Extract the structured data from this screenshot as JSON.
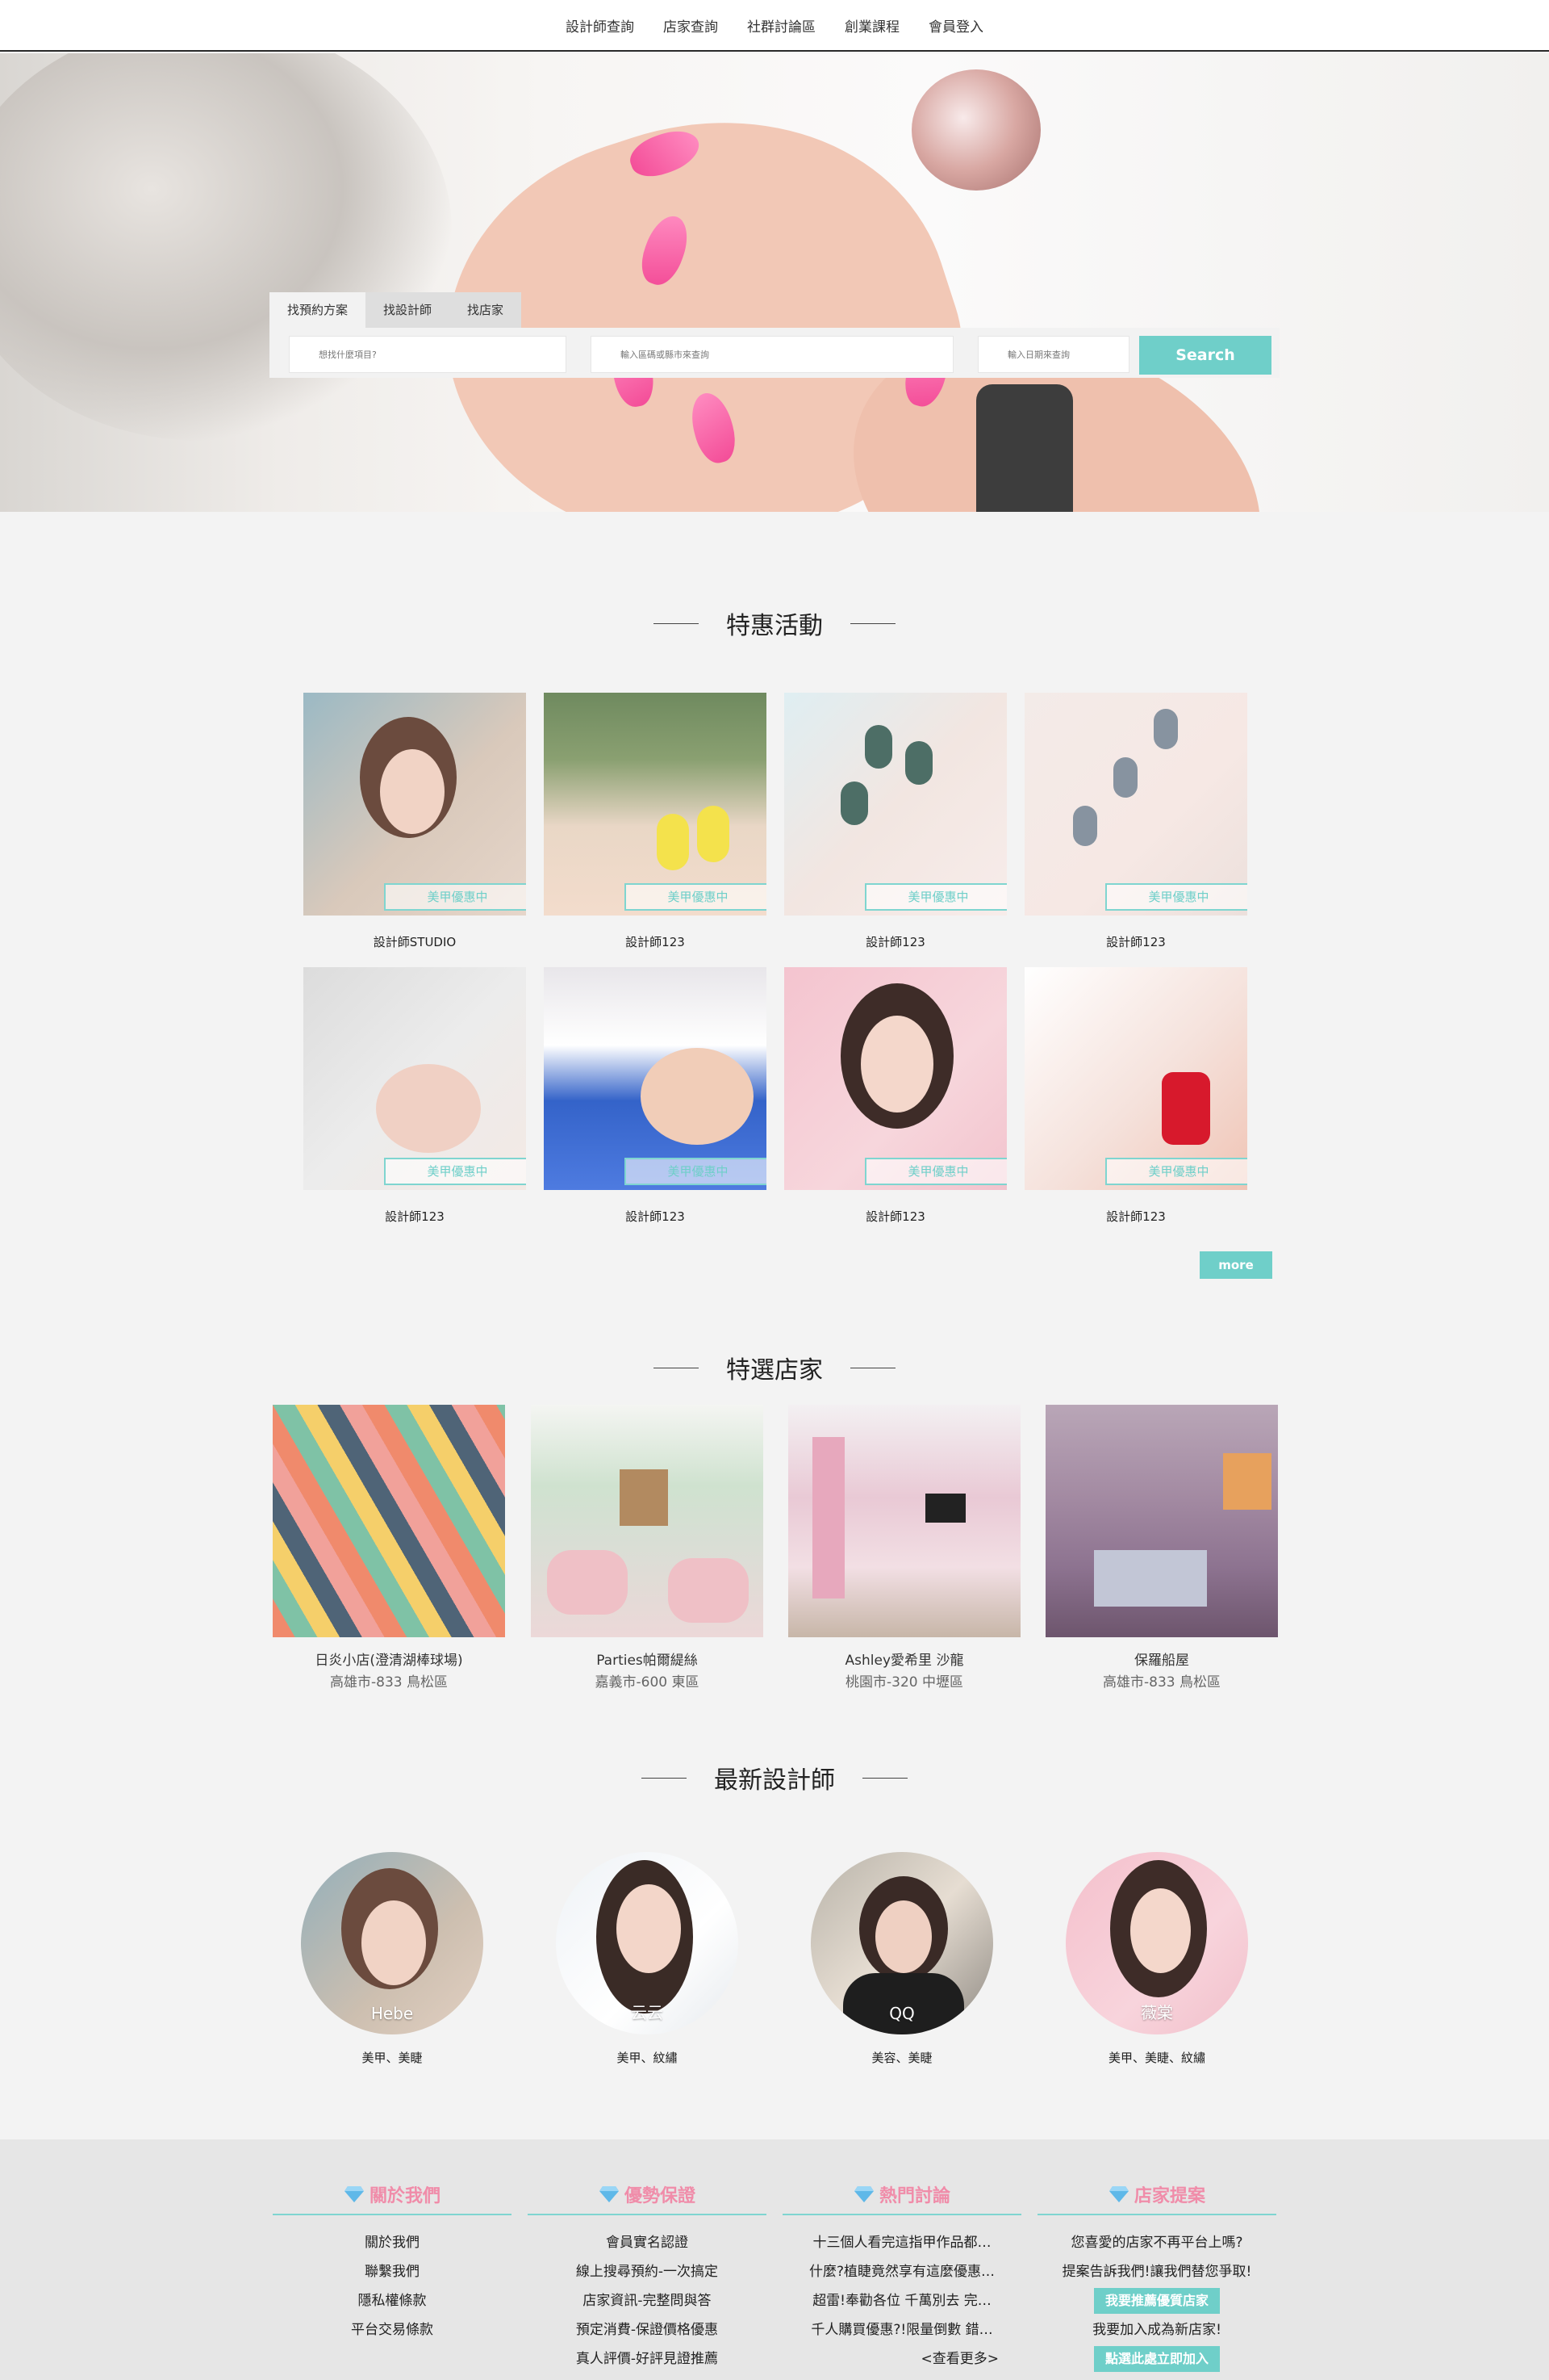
{
  "nav": [
    "設計師查詢",
    "店家查詢",
    "社群討論區",
    "創業課程",
    "會員登入"
  ],
  "search": {
    "tabs": [
      "找預約方案",
      "找設計師",
      "找店家"
    ],
    "item_placeholder": "想找什麼項目?",
    "area_placeholder": "輸入區碼或縣市來查詢",
    "date_placeholder": "輸入日期來查詢",
    "button": "Search"
  },
  "promos": {
    "title": "特惠活動",
    "badge": "美甲優惠中",
    "items": [
      {
        "name": "設計師STUDIO"
      },
      {
        "name": "設計師123"
      },
      {
        "name": "設計師123"
      },
      {
        "name": "設計師123"
      },
      {
        "name": "設計師123"
      },
      {
        "name": "設計師123"
      },
      {
        "name": "設計師123"
      },
      {
        "name": "設計師123"
      }
    ],
    "more": "more"
  },
  "shops": {
    "title": "特選店家",
    "items": [
      {
        "name": "日炎小店(澄清湖棒球場)",
        "addr": "高雄市-833 鳥松區"
      },
      {
        "name": "Parties帕爾緹絲",
        "addr": "嘉義市-600 東區"
      },
      {
        "name": "Ashley愛希里 沙龍",
        "addr": "桃園市-320 中壢區"
      },
      {
        "name": "保羅船屋",
        "addr": "高雄市-833 鳥松區"
      }
    ]
  },
  "designers": {
    "title": "最新設計師",
    "items": [
      {
        "name": "Hebe",
        "skills": "美甲、美睫"
      },
      {
        "name": "云云",
        "skills": "美甲、紋繡"
      },
      {
        "name": "QQ",
        "skills": "美容、美睫"
      },
      {
        "name": "薇棠",
        "skills": "美甲、美睫、紋繡"
      }
    ]
  },
  "footer": {
    "about": {
      "title": "關於我們",
      "links": [
        "關於我們",
        "聯繫我們",
        "隱私權條款",
        "平台交易條款"
      ]
    },
    "guarantee": {
      "title": "優勢保證",
      "links": [
        "會員實名認證",
        "線上搜尋預約-一次搞定",
        "店家資訊-完整問與答",
        "預定消費-保證價格優惠",
        "真人評價-好評見證推薦"
      ]
    },
    "hot": {
      "title": "熱門討論",
      "links": [
        "十三個人看完這指甲作品都…",
        "什麼?植睫竟然享有這麼優惠…",
        "超雷!奉勸各位 千萬別去 完…",
        "千人購買優惠?!限量倒數 錯…"
      ],
      "more": "<查看更多>"
    },
    "suggest": {
      "title": "店家提案",
      "line1": "您喜愛的店家不再平台上嗎?",
      "line2": "提案告訴我們!讓我們替您爭取!",
      "btn1": "我要推薦優質店家",
      "line3": "我要加入成為新店家!",
      "btn2": "點選此處立即加入"
    }
  }
}
